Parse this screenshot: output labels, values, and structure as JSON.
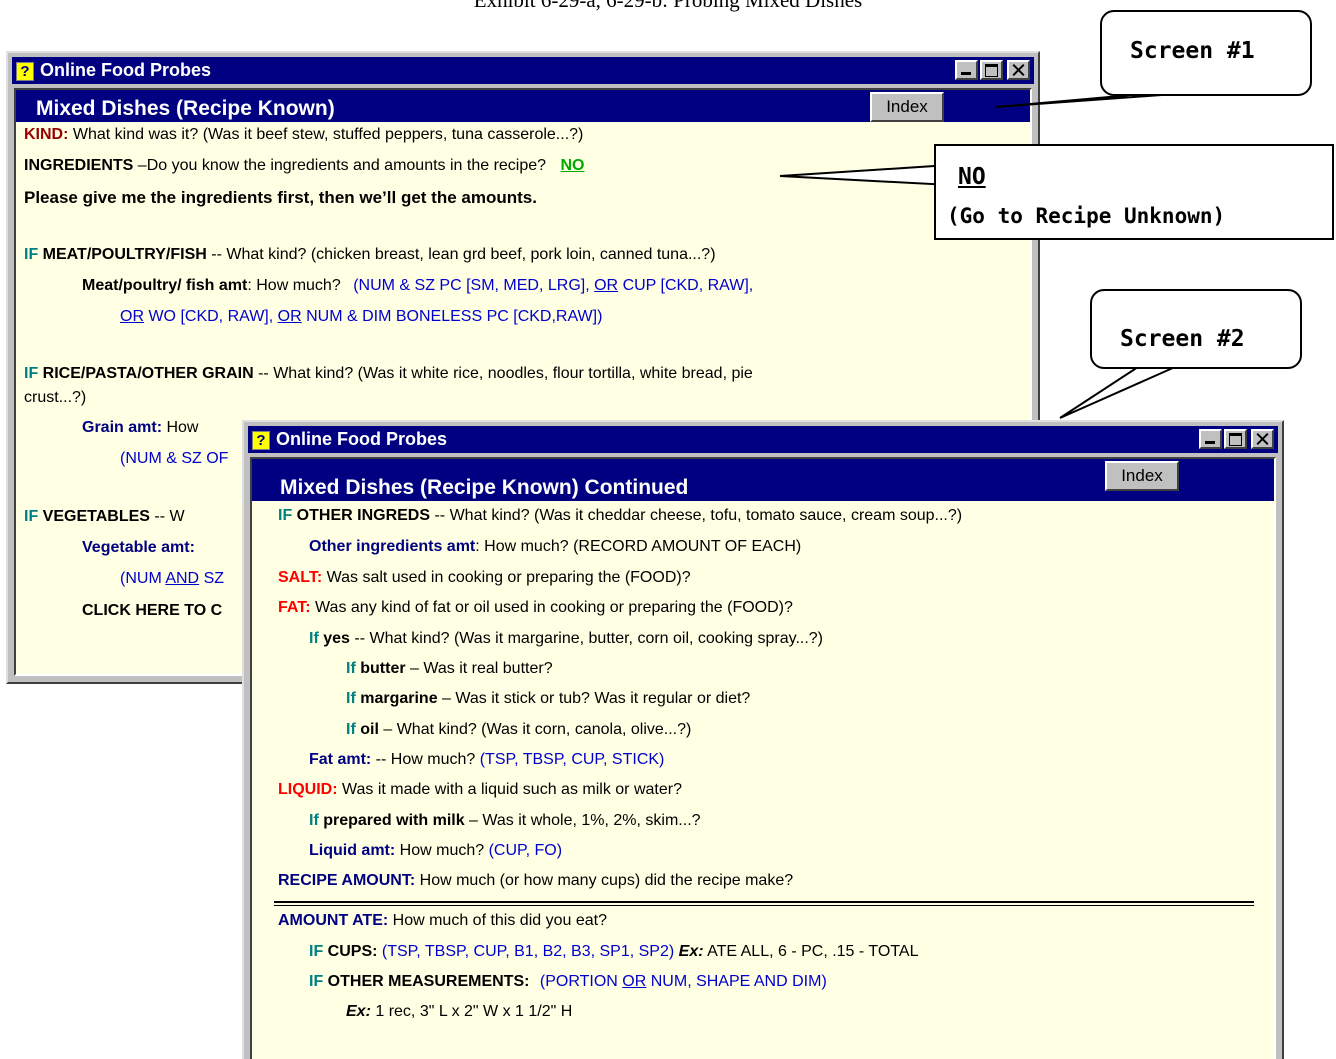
{
  "caption": "Exhibit 6-29-a, 6-29-b: Probing Mixed Dishes",
  "screen1": {
    "window_title": "Online Food Probes",
    "header": "Mixed Dishes (Recipe Known)",
    "index_button": "Index",
    "kind": {
      "label": "KIND:",
      "text": "What kind was it?  (Was it beef stew, stuffed peppers, tuna casserole...?)"
    },
    "ingredients": {
      "label": "INGREDIENTS",
      "text": " –Do you know the ingredients and amounts in the recipe?",
      "answer": "NO"
    },
    "instruction": "Please give me the ingredients first, then we’ll get the amounts.",
    "meat": {
      "if": "IF",
      "label": "MEAT/POULTRY/FISH",
      "text": " -- What kind?  (chicken breast, lean grd beef, pork loin, canned tuna...?)",
      "amt_label": "Meat/poultry/ fish amt",
      "amt_text": ":  How much?",
      "amt_opts_1a": "(NUM & SZ PC [SM, MED, LRG],",
      "or": "OR",
      "amt_opts_1b": "CUP [CKD, RAW],",
      "amt_opts_2a": "WO [CKD, RAW],",
      "amt_opts_2b": "NUM & DIM BONELESS PC [CKD,RAW])"
    },
    "grain": {
      "if": "IF",
      "label": "RICE/PASTA/OTHER GRAIN",
      "text": " -- What kind?  (Was it white rice, noodles, flour tortilla, white bread, pie",
      "text2": "crust...?)",
      "amt_label": "Grain amt:",
      "amt_text": " How",
      "amt_opts": "(NUM & SZ OF"
    },
    "veg": {
      "if": "IF",
      "label": "VEGETABLES",
      "text": " -- W",
      "amt_label": "Vegetable amt:",
      "amt_opts_a": "(NUM",
      "and": "AND",
      "amt_opts_b": "SZ"
    },
    "click_here": "CLICK HERE TO C"
  },
  "screen2": {
    "window_title": "Online Food Probes",
    "header": "Mixed Dishes (Recipe Known) Continued",
    "index_button": "Index",
    "other_ingreds": {
      "if": "IF",
      "label": "OTHER INGREDS",
      "text": " --  What kind?  (Was it cheddar cheese, tofu, tomato sauce, cream soup...?)"
    },
    "other_amt": {
      "label": "Other ingredients amt",
      "text": ":  How much?  (RECORD AMOUNT OF EACH)"
    },
    "salt": {
      "label": "SALT:",
      "text": " Was salt used in cooking or preparing the (FOOD)?"
    },
    "fat": {
      "label": "FAT:",
      "text": " Was any kind of fat or oil used in cooking or preparing the (FOOD)?"
    },
    "if_yes": {
      "if": "If",
      "label": "yes",
      "text": " -- What kind?  (Was it margarine, butter, corn oil, cooking spray...?)"
    },
    "if_butter": {
      "if": "If",
      "label": "butter",
      "text": " – Was it real butter?"
    },
    "if_margarine": {
      "if": "If",
      "label": "margarine",
      "text": " – Was it stick or tub?  Was it regular or diet?"
    },
    "if_oil": {
      "if": "If",
      "label": "oil",
      "text": " – What kind?  (Was it corn, canola, olive...?)"
    },
    "fat_amt": {
      "label": "Fat amt:",
      "text": " -- How much?",
      "opts": "(TSP, TBSP, CUP, STICK)"
    },
    "liquid": {
      "label": "LIQUID:",
      "text": " Was it made with a liquid such as milk or water?"
    },
    "if_milk": {
      "if": "If",
      "label": "prepared with milk",
      "text": " – Was it whole, 1%, 2%, skim...?"
    },
    "liquid_amt": {
      "label": "Liquid amt:",
      "text": " How much?",
      "opts": "(CUP, FO)"
    },
    "recipe_amount": {
      "label": "RECIPE AMOUNT:",
      "text": " How much (or how many cups) did the recipe make?"
    },
    "amount_ate": {
      "label": "AMOUNT ATE:",
      "text": " How much of this did you eat?"
    },
    "if_cups": {
      "if": "IF",
      "label": "CUPS:",
      "opts": "(TSP, TBSP, CUP, B1, B2, B3, SP1, SP2)",
      "ex": "Ex:",
      "ex_text": " ATE ALL, 6 - PC, .15 - TOTAL"
    },
    "if_other_meas": {
      "if": "IF",
      "label": "OTHER MEASUREMENTS:",
      "opts_a": "(PORTION",
      "or": "OR",
      "opts_b": "NUM, SHAPE AND DIM)"
    },
    "example": {
      "ex": "Ex:",
      "text": " 1 rec, 3\" L x 2\" W x 1 1/2\" H"
    }
  },
  "callouts": {
    "screen1": "Screen #1",
    "screen2": "Screen #2",
    "no_title": "NO",
    "no_text": "(Go to Recipe Unknown)"
  }
}
